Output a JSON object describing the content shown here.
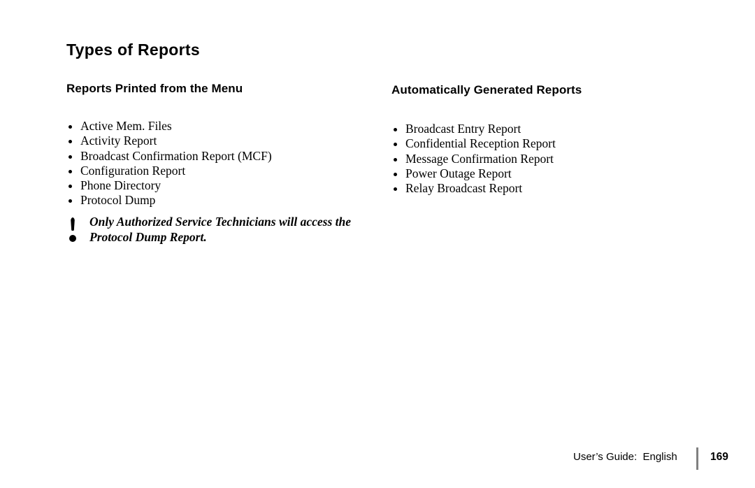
{
  "document": {
    "title": "Types of Reports"
  },
  "left_column": {
    "heading": "Reports Printed from the Menu",
    "items": [
      "Active Mem. Files",
      "Activity Report",
      "Broadcast Confirmation Report (MCF)",
      "Configuration Report",
      "Phone Directory",
      "Protocol Dump"
    ],
    "note": {
      "icon": "exclamation-icon",
      "line1": "Only Authorized Service Technicians will access the",
      "line2": "Protocol Dump Report."
    }
  },
  "right_column": {
    "heading": "Automatically Generated Reports",
    "items": [
      "Broadcast Entry Report",
      "Confidential Reception Report",
      "Message Confirmation Report",
      "Power Outage Report",
      "Relay Broadcast Report"
    ]
  },
  "footer": {
    "guide_label": "User’s Guide:  English",
    "page_number": "169",
    "divider_color": "#808080"
  }
}
